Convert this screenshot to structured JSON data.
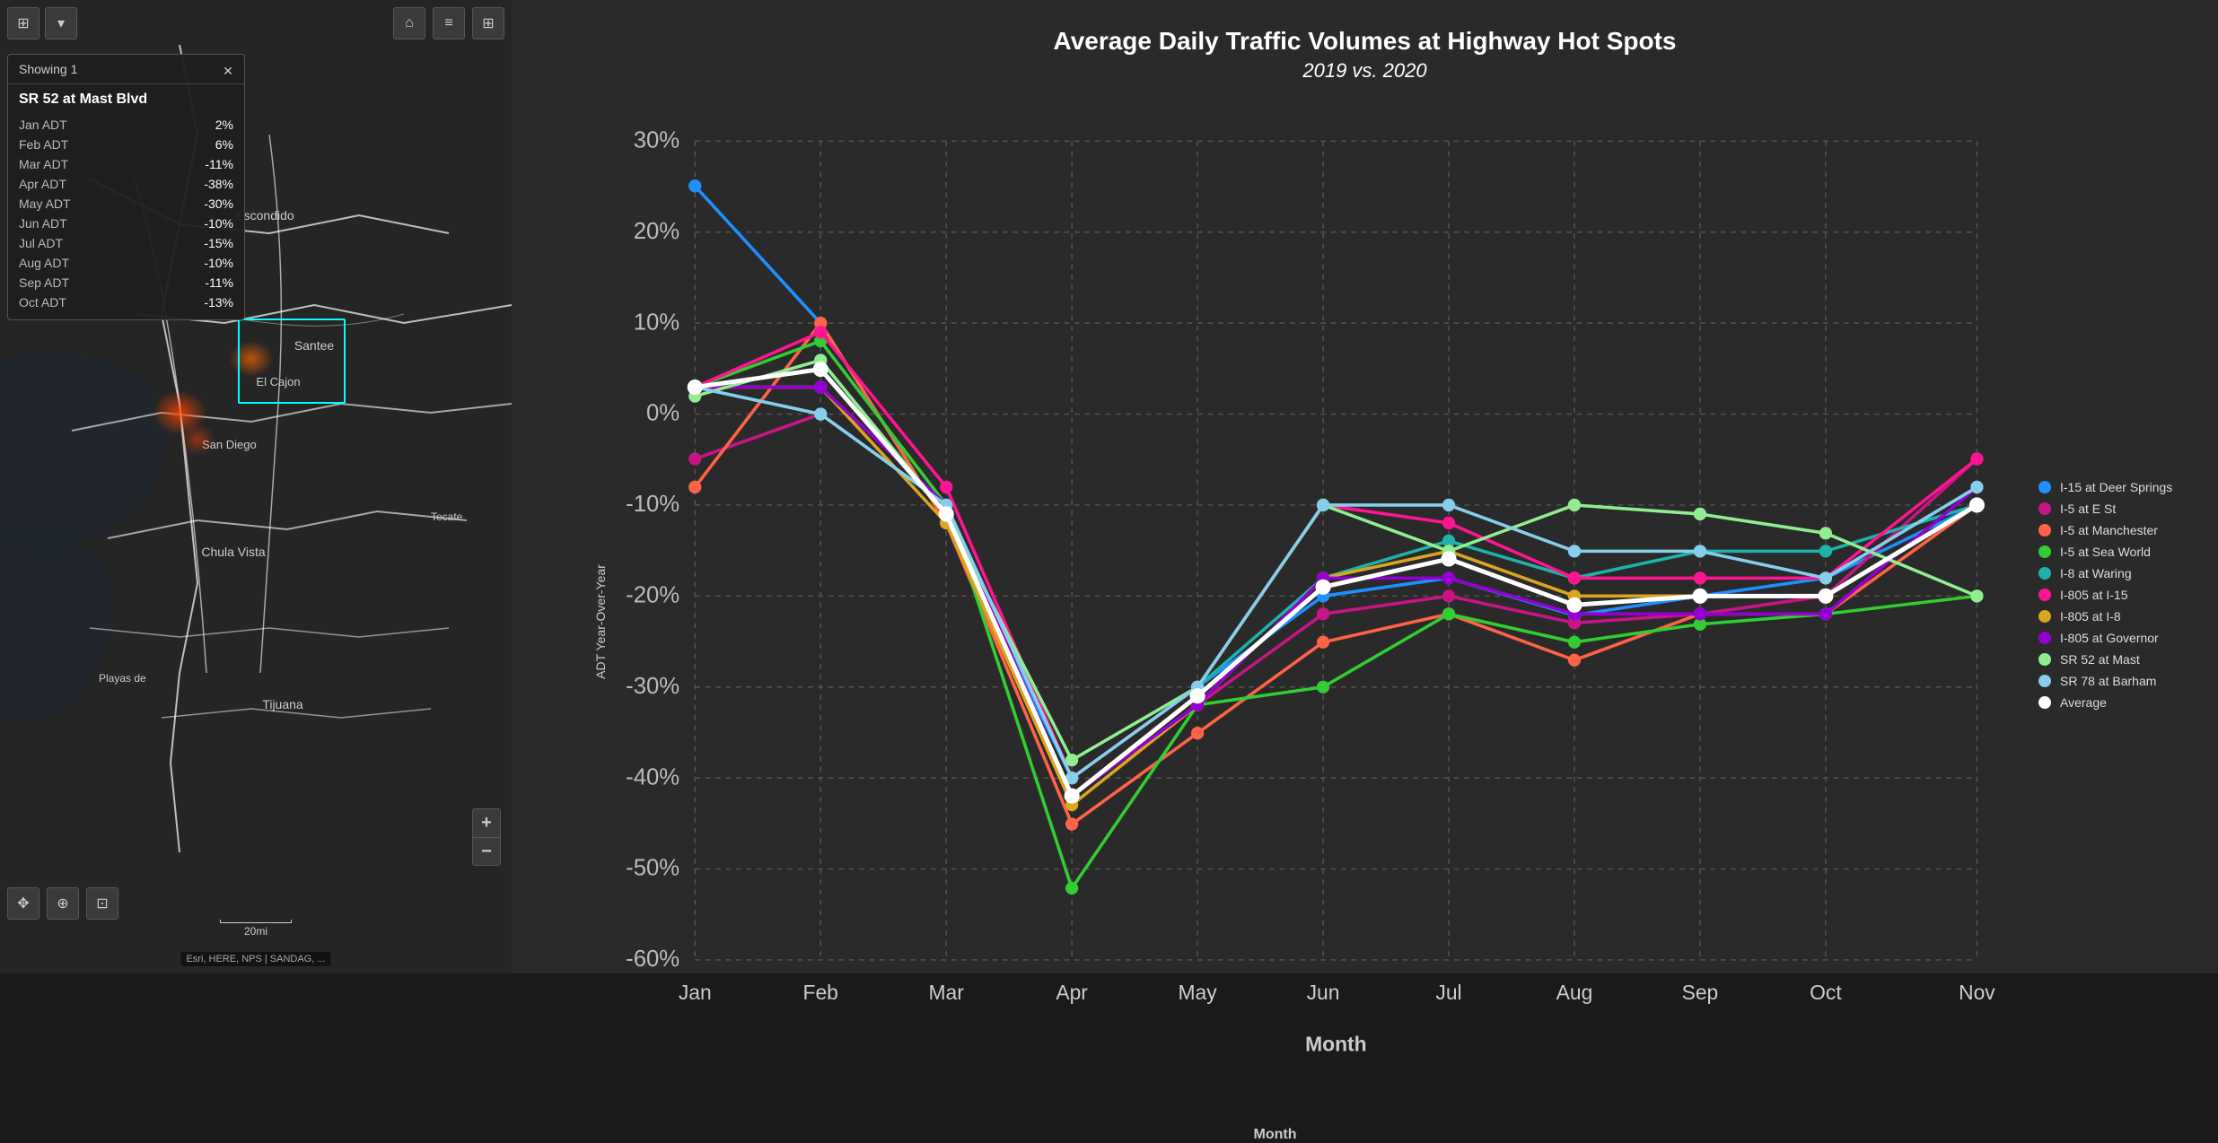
{
  "map": {
    "toolbar_left": [
      {
        "icon": "⊞",
        "label": "selection-tool"
      },
      {
        "icon": "▾",
        "label": "dropdown-arrow"
      }
    ],
    "toolbar_right": [
      {
        "icon": "⌂",
        "label": "home-icon"
      },
      {
        "icon": "≡",
        "label": "list-icon"
      },
      {
        "icon": "⊞",
        "label": "grid-icon"
      }
    ],
    "info_panel": {
      "showing_label": "Showing 1",
      "location_title": "SR 52 at Mast Blvd",
      "rows": [
        {
          "label": "Jan ADT",
          "value": "2%"
        },
        {
          "label": "Feb ADT",
          "value": "6%"
        },
        {
          "label": "Mar ADT",
          "value": "-11%"
        },
        {
          "label": "Apr ADT",
          "value": "-38%"
        },
        {
          "label": "May ADT",
          "value": "-30%"
        },
        {
          "label": "Jun ADT",
          "value": "-10%"
        },
        {
          "label": "Jul ADT",
          "value": "-15%"
        },
        {
          "label": "Aug ADT",
          "value": "-10%"
        },
        {
          "label": "Sep ADT",
          "value": "-11%"
        },
        {
          "label": "Oct ADT",
          "value": "-13%"
        }
      ]
    },
    "bottom_tools": [
      "✥",
      "⊕",
      "⊡"
    ],
    "zoom_plus": "+",
    "zoom_minus": "−",
    "scale_label": "20mi",
    "attribution": "Esri, HERE, NPS | SANDAG, ..."
  },
  "chart": {
    "title": "Average Daily Traffic Volumes at Highway Hot Spots",
    "subtitle": "2019 vs. 2020",
    "y_axis_label": "ADT Year-Over-Year",
    "x_axis_label": "Month",
    "y_ticks": [
      "30%",
      "20%",
      "10%",
      "0%",
      "-10%",
      "-20%",
      "-30%",
      "-40%",
      "-50%",
      "-60%"
    ],
    "x_ticks": [
      "Jan",
      "Feb",
      "Mar",
      "Apr",
      "May",
      "Jun",
      "Jul",
      "Aug",
      "Sep",
      "Oct",
      "Nov"
    ],
    "legend": [
      {
        "label": "I-15 at Deer Springs",
        "color": "#1E90FF"
      },
      {
        "label": "I-5 at E St",
        "color": "#C71585"
      },
      {
        "label": "I-5 at Manchester",
        "color": "#FF6347"
      },
      {
        "label": "I-5 at Sea World",
        "color": "#32CD32"
      },
      {
        "label": "I-8 at Waring",
        "color": "#20B2AA"
      },
      {
        "label": "I-805 at I-15",
        "color": "#FF1493"
      },
      {
        "label": "I-805 at I-8",
        "color": "#DAA520"
      },
      {
        "label": "I-805 at Governor",
        "color": "#9400D3"
      },
      {
        "label": "SR 52 at Mast",
        "color": "#90EE90"
      },
      {
        "label": "SR 78 at Barham",
        "color": "#87CEEB"
      },
      {
        "label": "Average",
        "color": "#FFFFFF"
      }
    ]
  }
}
